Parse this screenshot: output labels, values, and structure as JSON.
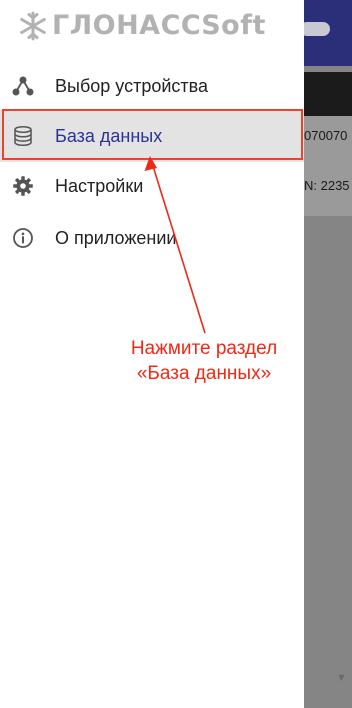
{
  "logo": {
    "text": "ГЛОНАССSoft"
  },
  "menu": {
    "items": [
      {
        "label": "Выбор устройства",
        "icon": "device-select-icon"
      },
      {
        "label": "База данных",
        "icon": "database-icon"
      },
      {
        "label": "Настройки",
        "icon": "gear-icon"
      },
      {
        "label": "О приложении",
        "icon": "info-icon"
      }
    ],
    "active_index": 1
  },
  "background": {
    "row1_text": "070070",
    "row2_text": "N: 2235",
    "corner_glyph": "▼"
  },
  "annotation": {
    "line1": "Нажмите раздел",
    "line2": "«База данных»"
  },
  "colors": {
    "accent": "#2b3490",
    "annotation": "#ee2a16",
    "appbar": "#2b2f7a"
  }
}
